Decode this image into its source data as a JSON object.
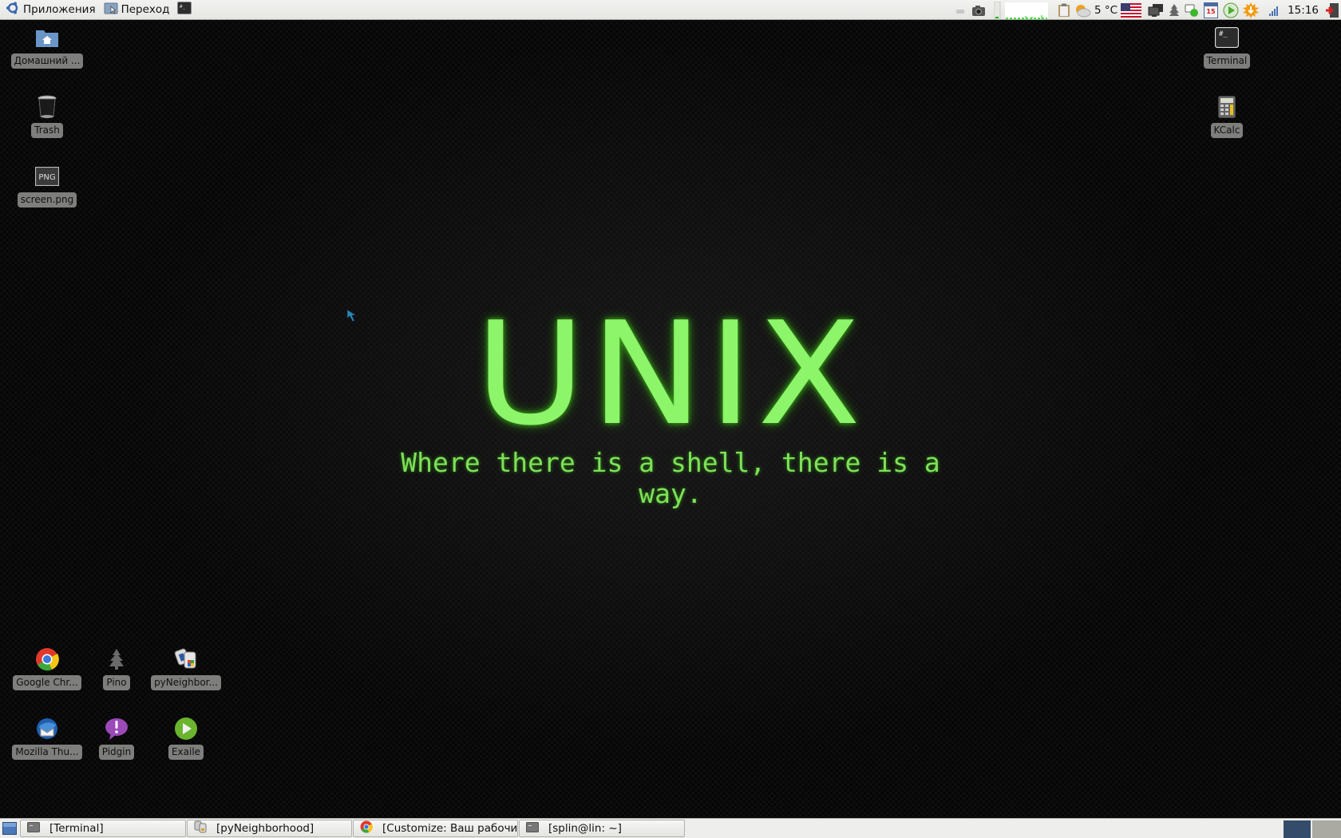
{
  "top_panel": {
    "menus": [
      {
        "label": "Приложения",
        "icon": "applications-menu-icon"
      },
      {
        "label": "Переход",
        "icon": "places-folder-icon"
      },
      {
        "label": "",
        "icon": "terminal-launcher-icon"
      }
    ],
    "tray": {
      "weather_temp": "5 °C",
      "clock": "15:16",
      "calendar_day": "15",
      "keyboard_layout": "en-US"
    }
  },
  "desktop": {
    "icons_left": [
      {
        "label": "Домашний ...",
        "icon": "home-folder-icon"
      },
      {
        "label": "Trash",
        "icon": "trash-icon"
      },
      {
        "label": "screen.png",
        "icon": "png-file-icon",
        "badge": "PNG"
      }
    ],
    "icons_right": [
      {
        "label": "Terminal",
        "icon": "terminal-icon",
        "glyph": "#_"
      },
      {
        "label": "KCalc",
        "icon": "calculator-icon"
      }
    ],
    "icons_bottom": [
      {
        "label": "Google Chr...",
        "icon": "chrome-icon"
      },
      {
        "label": "Pino",
        "icon": "pino-tree-icon"
      },
      {
        "label": "pyNeighbor...",
        "icon": "pyneighborhood-icon"
      },
      {
        "label": "Mozilla Thu...",
        "icon": "thunderbird-icon"
      },
      {
        "label": "Pidgin",
        "icon": "pidgin-icon"
      },
      {
        "label": "Exaile",
        "icon": "exaile-icon"
      }
    ],
    "wallpaper": {
      "title": "UNIX",
      "tagline": "Where there is a shell, there is a way.",
      "accent": "#8cf56a"
    }
  },
  "taskbar": {
    "tasks": [
      {
        "label": "[Terminal]",
        "icon": "terminal-icon"
      },
      {
        "label": "[pyNeighborhood]",
        "icon": "pyneighborhood-icon"
      },
      {
        "label": "[Customize: Ваш рабочий...",
        "icon": "chrome-icon"
      },
      {
        "label": "[splin@lin: ~]",
        "icon": "terminal-icon"
      }
    ],
    "workspaces": [
      {
        "active": true,
        "color": "#344b6a"
      },
      {
        "active": false,
        "color": "#aaaaa2"
      }
    ]
  }
}
